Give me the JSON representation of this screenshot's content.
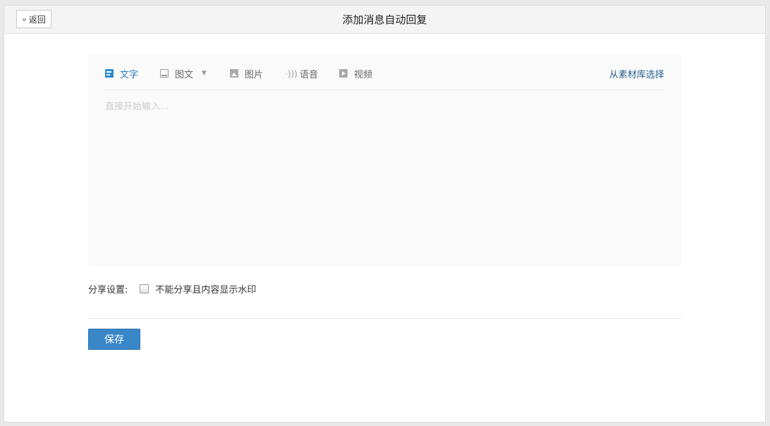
{
  "header": {
    "back_label": "返回",
    "title": "添加消息自动回复"
  },
  "editor": {
    "tabs": [
      {
        "label": "文字",
        "icon": "text-icon",
        "active": true
      },
      {
        "label": "图文",
        "icon": "news-icon",
        "active": false
      },
      {
        "label": "图片",
        "icon": "image-icon",
        "active": false
      },
      {
        "label": "语音",
        "icon": "voice-icon",
        "active": false
      },
      {
        "label": "视频",
        "icon": "video-icon",
        "active": false
      }
    ],
    "library_link": "从素材库选择",
    "placeholder": "直接开始输入..."
  },
  "share": {
    "label": "分享设置:",
    "option": "不能分享且内容显示水印",
    "checked": false
  },
  "actions": {
    "save_label": "保存"
  },
  "colors": {
    "accent": "#3a87c8",
    "link": "#2a5e8f",
    "active_tab": "#2f7bc0"
  }
}
